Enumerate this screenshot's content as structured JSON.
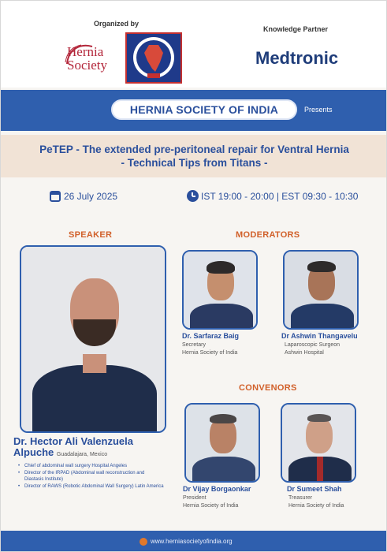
{
  "header": {
    "organized_by": "Organized by",
    "knowledge_partner": "Knowledge Partner",
    "hernia_society_logo_text": "Hernia Society",
    "medtronic": "Medtronic"
  },
  "band": {
    "society": "HERNIA SOCIETY OF INDIA",
    "presents": "Presents"
  },
  "title": {
    "line1": "PeTEP - The extended pre-peritoneal repair for Ventral Hernia",
    "line2": "- Technical Tips from Titans -"
  },
  "schedule": {
    "date": "26 July 2025",
    "time": "IST 19:00 - 20:00 | EST 09:30 - 10:30"
  },
  "speaker": {
    "heading": "SPEAKER",
    "name_line1": "Dr. Hector Ali Valenzuela",
    "name_line2": "Alpuche",
    "location": "Guadalajara, Mexico",
    "bullets": [
      "Chief of abdominal wall surgery Hospital Angeles",
      "Director of the IRPAD (Abdominal wall reconstruction and Diastasis Institute)",
      "Director of RAWS (Robotic Abdominal Wall Surgery) Latin America"
    ]
  },
  "moderators": {
    "heading": "MODERATORS",
    "people": [
      {
        "name": "Dr. Sarfaraz Baig",
        "role": "Secretary",
        "org": "Hernia Society of India"
      },
      {
        "name": "Dr Ashwin Thangavelu",
        "role": "Laparoscopic Surgeon",
        "org": "Ashwin Hospital"
      }
    ]
  },
  "convenors": {
    "heading": "CONVENORS",
    "people": [
      {
        "name": "Dr Vijay Borgaonkar",
        "role": "President",
        "org": "Hernia Society of India"
      },
      {
        "name": "Dr Sumeet Shah",
        "role": "Treasurer",
        "org": "Hernia Society of India"
      }
    ]
  },
  "footer": {
    "website": "www.herniasocietyofindia.org"
  },
  "colors": {
    "brand_blue": "#2f5fae",
    "accent_orange": "#d1602a",
    "title_bg": "#f1e3d6"
  }
}
